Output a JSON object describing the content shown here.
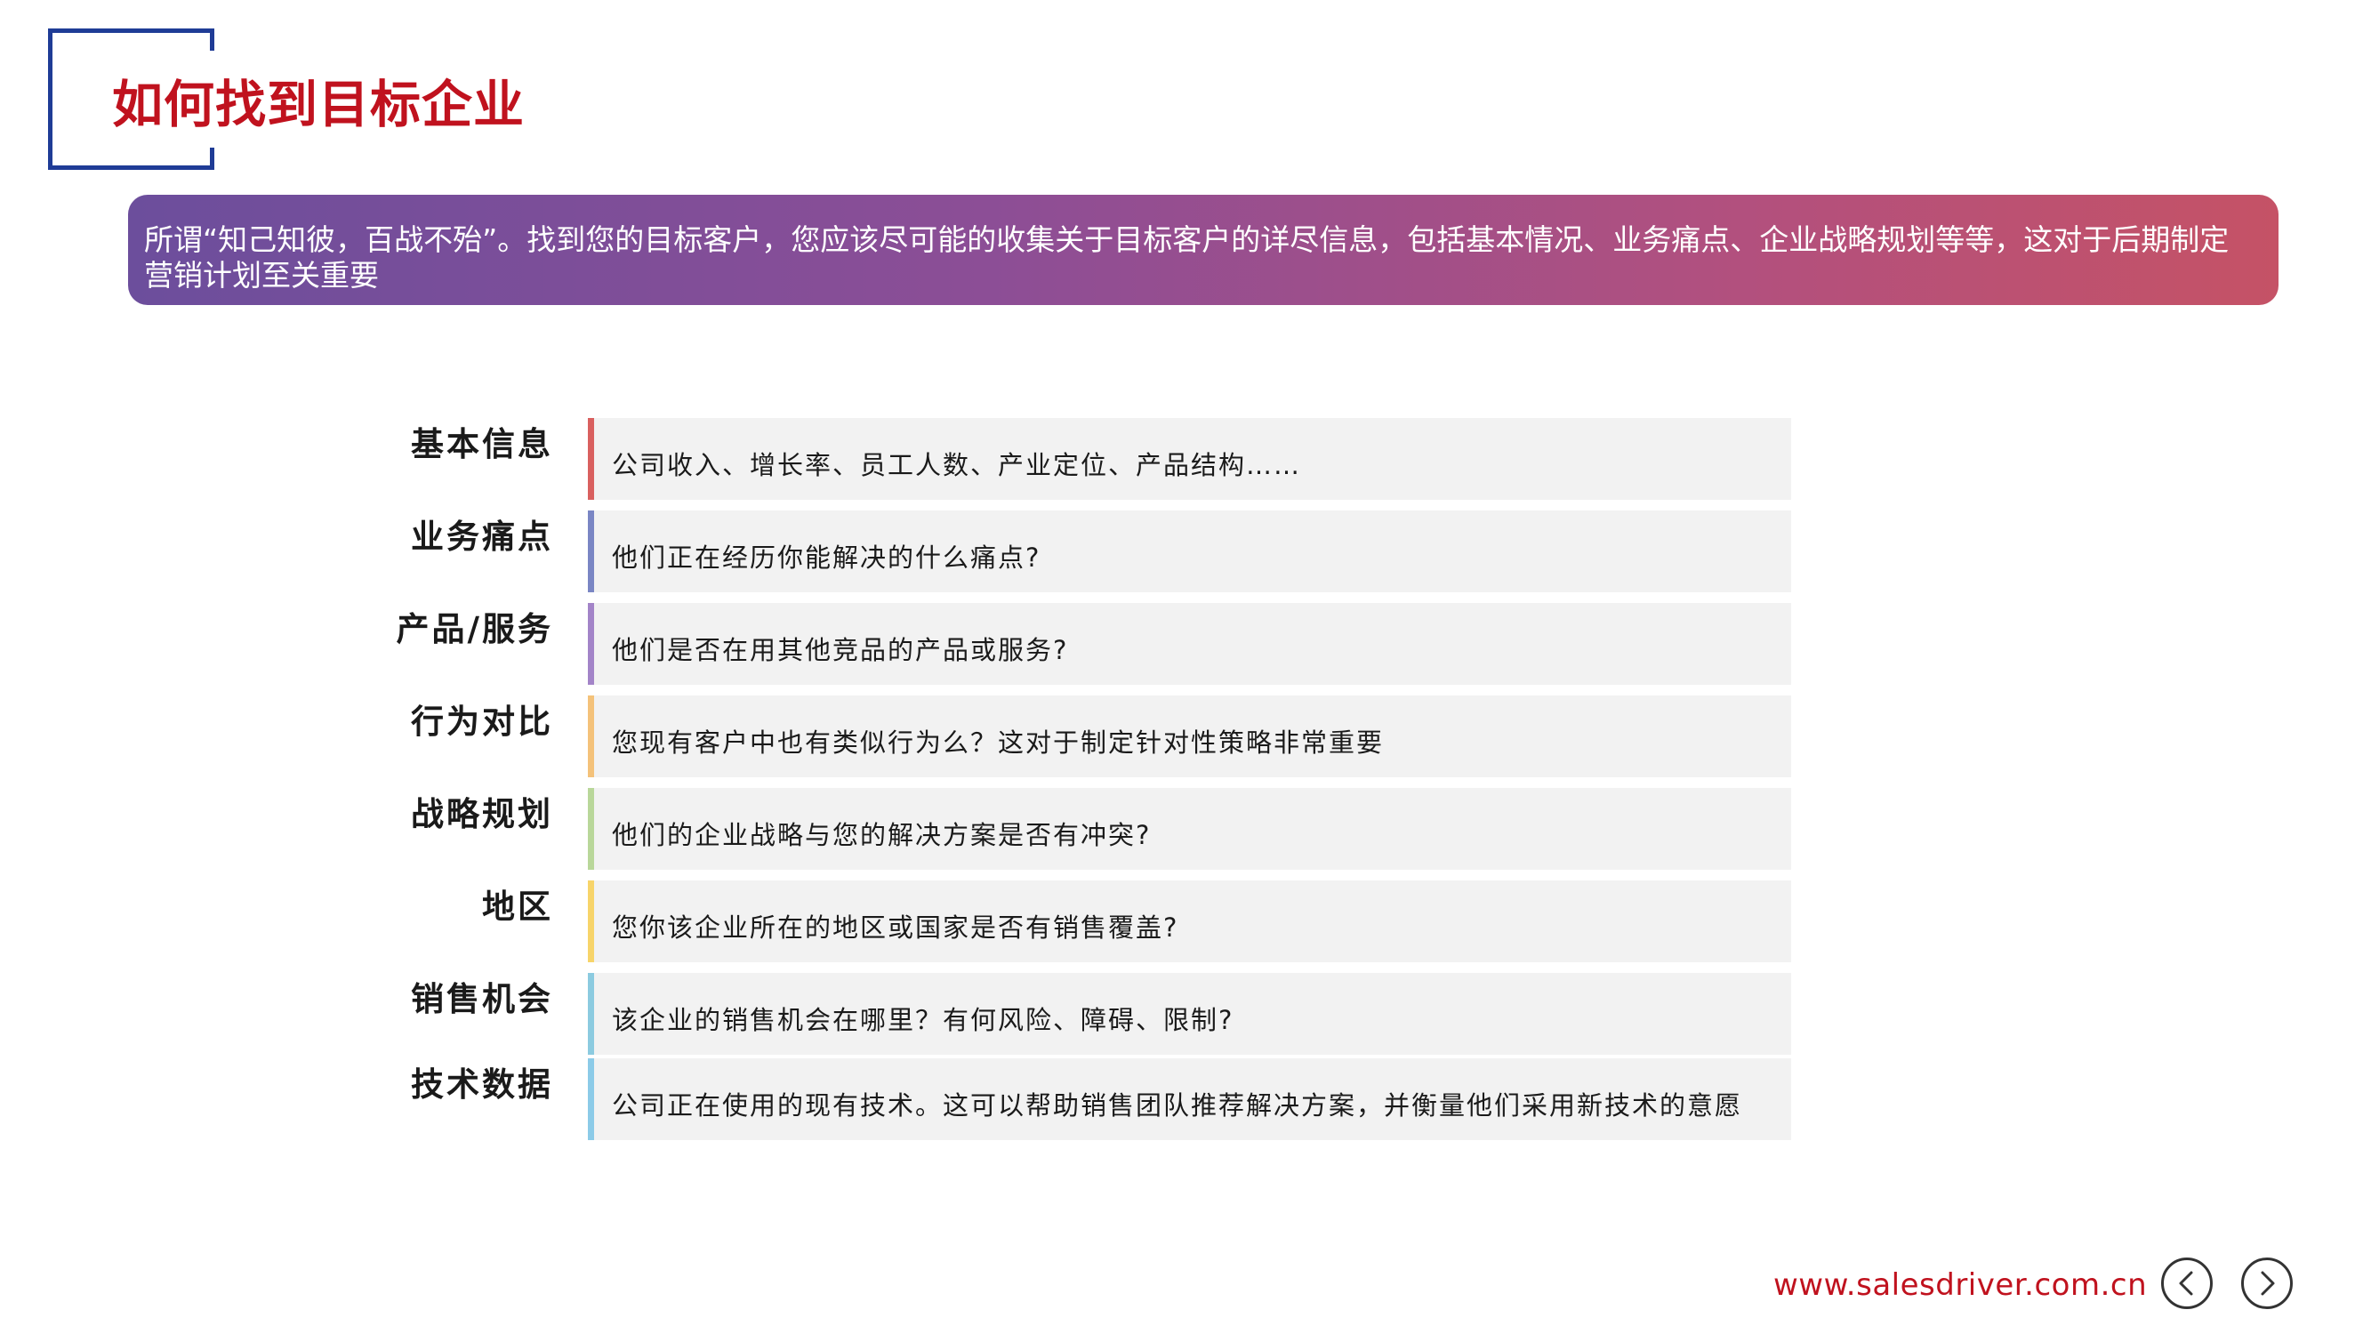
{
  "header": {
    "title": "如何找到目标企业"
  },
  "intro": {
    "text": "所谓“知己知彼，百战不殆”。找到您的目标客户，您应该尽可能的收集关于目标客户的详尽信息，包括基本情况、业务痛点、企业战略规划等等，这对于后期制定营销计划至关重要"
  },
  "rows": [
    {
      "label": "基本信息",
      "text": "公司收入、增长率、员工人数、产业定位、产品结构……",
      "color": "#d9605f"
    },
    {
      "label": "业务痛点",
      "text": "他们正在经历你能解决的什么痛点?",
      "color": "#7a86c4"
    },
    {
      "label": "产品/服务",
      "text": "他们是否在用其他竞品的产品或服务?",
      "color": "#a384c8"
    },
    {
      "label": "行为对比",
      "text": "您现有客户中也有类似行为么？这对于制定针对性策略非常重要",
      "color": "#f4c27a"
    },
    {
      "label": "战略规划",
      "text": "他们的企业战略与您的解决方案是否有冲突?",
      "color": "#b9d79a"
    },
    {
      "label": "地区",
      "text": "您你该企业所在的地区或国家是否有销售覆盖?",
      "color": "#f7d46a"
    },
    {
      "label": "销售机会",
      "text": "该企业的销售机会在哪里？有何风险、障碍、限制?",
      "color": "#8ccbe0"
    },
    {
      "label": "技术数据",
      "text": "公司正在使用的现有技术。这可以帮助销售团队推荐解决方案，并衡量他们采用新技术的意愿",
      "color": "#8ccbe8"
    }
  ],
  "footer": {
    "url": "www.salesdriver.com.cn",
    "prev_icon": "chevron-left-circle",
    "next_icon": "chevron-right-circle"
  },
  "colors": {
    "title_red": "#c0121e",
    "frame_blue": "#1f3c96",
    "banner_gradient": [
      "#6c4e9c",
      "#c55266"
    ]
  }
}
